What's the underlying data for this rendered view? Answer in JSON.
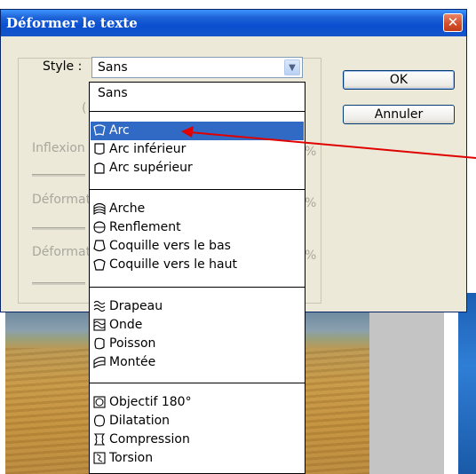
{
  "dialog": {
    "title": "Déformer le texte",
    "close_symbol": "✕",
    "style_label": "Style :",
    "style_value": "Sans",
    "ok_label": "OK",
    "cancel_label": "Annuler",
    "faded_labels": [
      "Inflexion",
      "Déformat",
      "Déformat"
    ],
    "faded_marks": [
      "(",
      "%",
      "%",
      "%"
    ]
  },
  "dropdown": {
    "items": [
      {
        "label": "Sans",
        "icon": "none"
      },
      {
        "label": "Arc",
        "icon": "arc-icon",
        "selected": true
      },
      {
        "label": "Arc inférieur",
        "icon": "arc-lower-icon"
      },
      {
        "label": "Arc supérieur",
        "icon": "arc-upper-icon"
      },
      {
        "label": "Arche",
        "icon": "arch-icon"
      },
      {
        "label": "Renflement",
        "icon": "bulge-icon"
      },
      {
        "label": "Coquille vers le bas",
        "icon": "shell-lower-icon"
      },
      {
        "label": "Coquille vers le haut",
        "icon": "shell-upper-icon"
      },
      {
        "label": "Drapeau",
        "icon": "flag-icon"
      },
      {
        "label": "Onde",
        "icon": "wave-icon"
      },
      {
        "label": "Poisson",
        "icon": "fish-icon"
      },
      {
        "label": "Montée",
        "icon": "rise-icon"
      },
      {
        "label": "Objectif 180°",
        "icon": "fisheye-icon"
      },
      {
        "label": "Dilatation",
        "icon": "inflate-icon"
      },
      {
        "label": "Compression",
        "icon": "squeeze-icon"
      },
      {
        "label": "Torsion",
        "icon": "twist-icon"
      }
    ]
  },
  "colors": {
    "selection": "#316ac5",
    "arrow": "#e00000",
    "titlebar": "#0a4fd0"
  }
}
